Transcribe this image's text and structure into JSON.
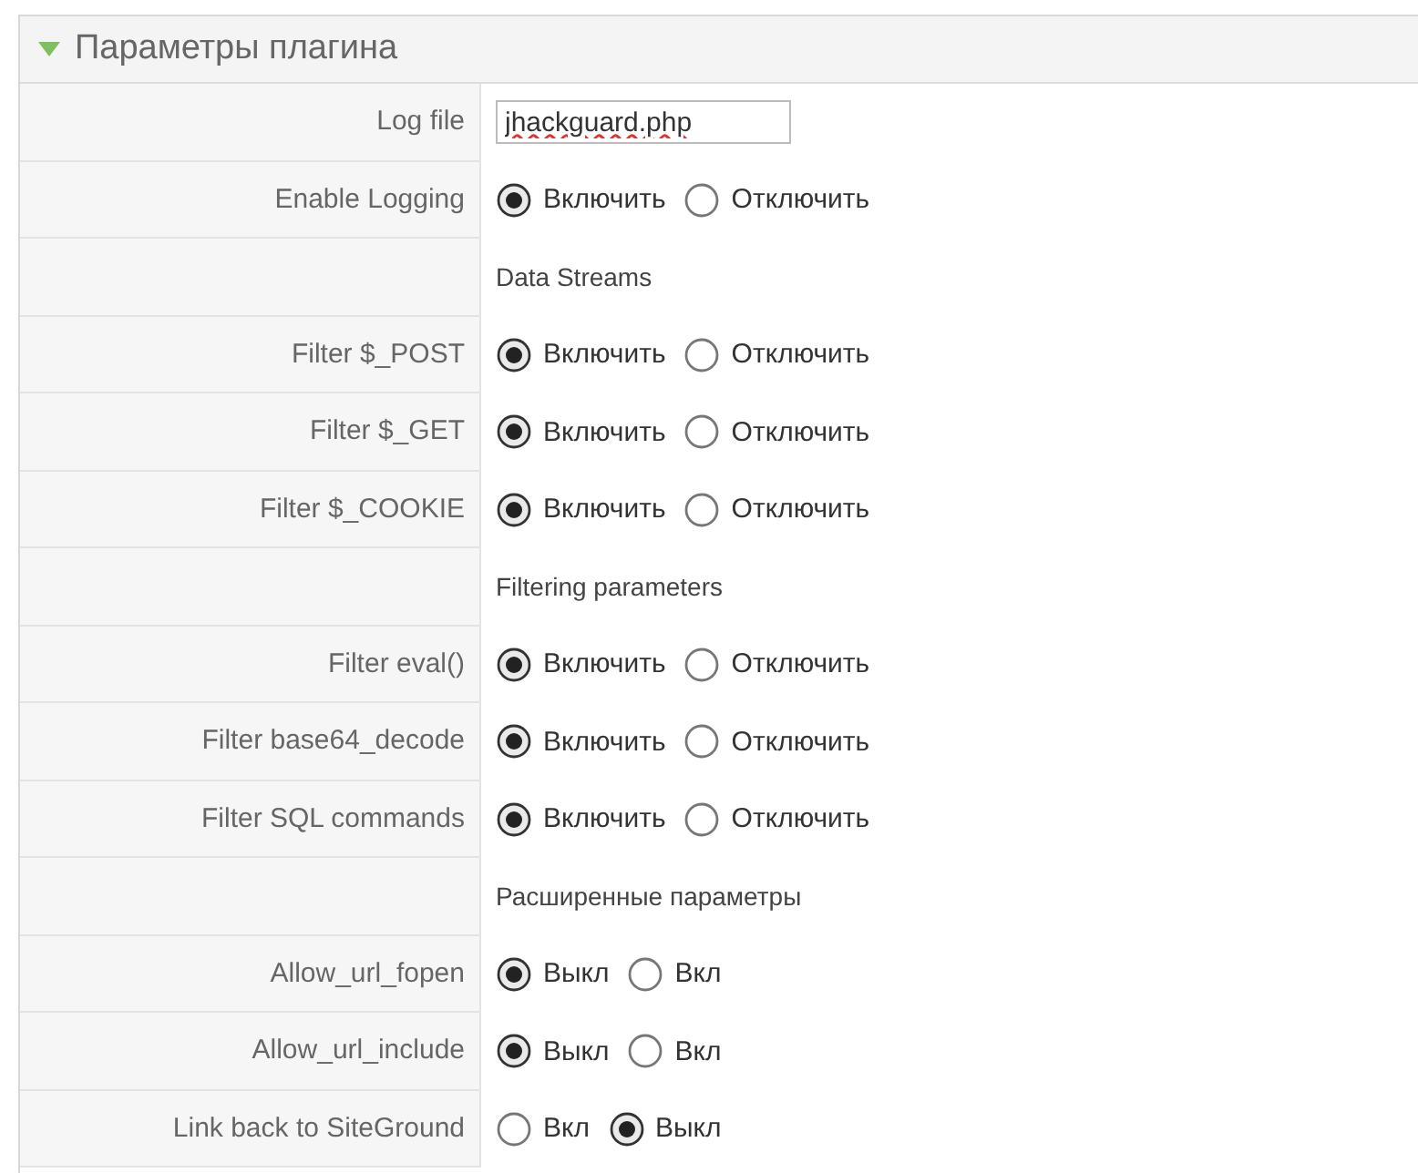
{
  "panel": {
    "title": "Параметры плагина",
    "expanded": true
  },
  "rows": [
    {
      "kind": "text",
      "label": "Log file",
      "value": "jhackguard.php"
    },
    {
      "kind": "radio",
      "label": "Enable Logging",
      "options": [
        {
          "label": "Включить",
          "selected": true
        },
        {
          "label": "Отключить",
          "selected": false
        }
      ]
    },
    {
      "kind": "section",
      "title": "Data Streams"
    },
    {
      "kind": "radio",
      "label": "Filter $_POST",
      "options": [
        {
          "label": "Включить",
          "selected": true
        },
        {
          "label": "Отключить",
          "selected": false
        }
      ]
    },
    {
      "kind": "radio",
      "label": "Filter $_GET",
      "options": [
        {
          "label": "Включить",
          "selected": true
        },
        {
          "label": "Отключить",
          "selected": false
        }
      ]
    },
    {
      "kind": "radio",
      "label": "Filter $_COOKIE",
      "options": [
        {
          "label": "Включить",
          "selected": true
        },
        {
          "label": "Отключить",
          "selected": false
        }
      ]
    },
    {
      "kind": "section",
      "title": "Filtering parameters"
    },
    {
      "kind": "radio",
      "label": "Filter eval()",
      "options": [
        {
          "label": "Включить",
          "selected": true
        },
        {
          "label": "Отключить",
          "selected": false
        }
      ]
    },
    {
      "kind": "radio",
      "label": "Filter base64_decode",
      "options": [
        {
          "label": "Включить",
          "selected": true
        },
        {
          "label": "Отключить",
          "selected": false
        }
      ]
    },
    {
      "kind": "radio",
      "label": "Filter SQL commands",
      "options": [
        {
          "label": "Включить",
          "selected": true
        },
        {
          "label": "Отключить",
          "selected": false
        }
      ]
    },
    {
      "kind": "section",
      "title": "Расширенные параметры"
    },
    {
      "kind": "radio",
      "label": "Allow_url_fopen",
      "options": [
        {
          "label": "Выкл",
          "selected": true
        },
        {
          "label": "Вкл",
          "selected": false
        }
      ]
    },
    {
      "kind": "radio",
      "label": "Allow_url_include",
      "options": [
        {
          "label": "Выкл",
          "selected": true
        },
        {
          "label": "Вкл",
          "selected": false
        }
      ]
    },
    {
      "kind": "radio",
      "label": "Link back to SiteGround",
      "options": [
        {
          "label": "Вкл",
          "selected": false
        },
        {
          "label": "Выкл",
          "selected": true
        }
      ]
    }
  ]
}
